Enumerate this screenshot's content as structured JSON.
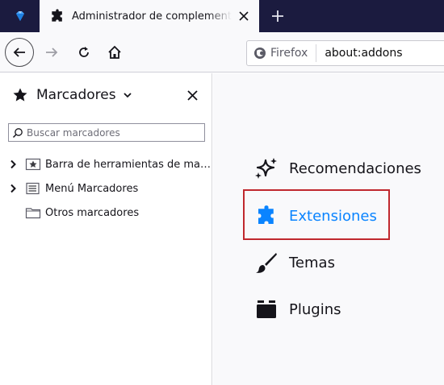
{
  "tabs": {
    "active_title": "Administrador de complementos",
    "close_icon": "close-icon",
    "new_tab_icon": "plus-icon"
  },
  "navbar": {
    "identity_label": "Firefox",
    "url": "about:addons"
  },
  "sidebar": {
    "title": "Marcadores",
    "search_placeholder": "Buscar marcadores",
    "items": [
      {
        "label": "Barra de herramientas de marcadores",
        "icon": "bookmarks-toolbar-icon",
        "expandable": true
      },
      {
        "label": "Menú Marcadores",
        "icon": "bookmarks-menu-icon",
        "expandable": true
      },
      {
        "label": "Otros marcadores",
        "icon": "folder-icon",
        "expandable": false
      }
    ]
  },
  "categories": [
    {
      "label": "Recomendaciones",
      "icon": "sparkles-icon",
      "selected": false
    },
    {
      "label": "Extensiones",
      "icon": "puzzle-icon",
      "selected": true
    },
    {
      "label": "Temas",
      "icon": "brush-icon",
      "selected": false
    },
    {
      "label": "Plugins",
      "icon": "plugin-icon",
      "selected": false
    }
  ],
  "colors": {
    "tabstrip": "#1b1b3f",
    "accent": "#0a84ff",
    "highlight_box": "#c0282e"
  }
}
